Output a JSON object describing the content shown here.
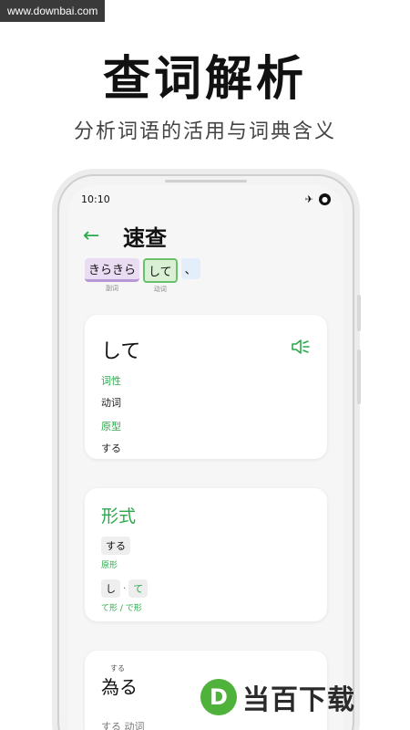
{
  "watermark_top": "www.downbai.com",
  "hero": {
    "title": "查词解析",
    "subtitle": "分析词语的活用与词典含义"
  },
  "status_bar": {
    "time": "10:10",
    "icons": [
      "airplane-icon",
      "notification-icon"
    ]
  },
  "appbar": {
    "back_icon": "back-arrow-icon",
    "title": "速查"
  },
  "tokens": [
    {
      "text": "きらきら",
      "pos": "副词"
    },
    {
      "text": "して",
      "pos": "动词"
    },
    {
      "text": "、",
      "pos": ""
    }
  ],
  "card1": {
    "word": "して",
    "pos_label": "词性",
    "pos_value": "动词",
    "base_label": "原型",
    "base_value": "する",
    "icon": "speaker-icon"
  },
  "card2": {
    "heading": "形式",
    "base_chip": "する",
    "base_label": "原形",
    "te_chip_1": "し",
    "te_sep": "·",
    "te_chip_2": "て",
    "te_label": "て形 / で形"
  },
  "card3": {
    "reading": "する",
    "word": "為る",
    "meta": "する 动词"
  },
  "watermark_brand": {
    "logo": "D",
    "text": "当百下载"
  },
  "colors": {
    "accent": "#2aa94a",
    "brand": "#4fb23a"
  }
}
